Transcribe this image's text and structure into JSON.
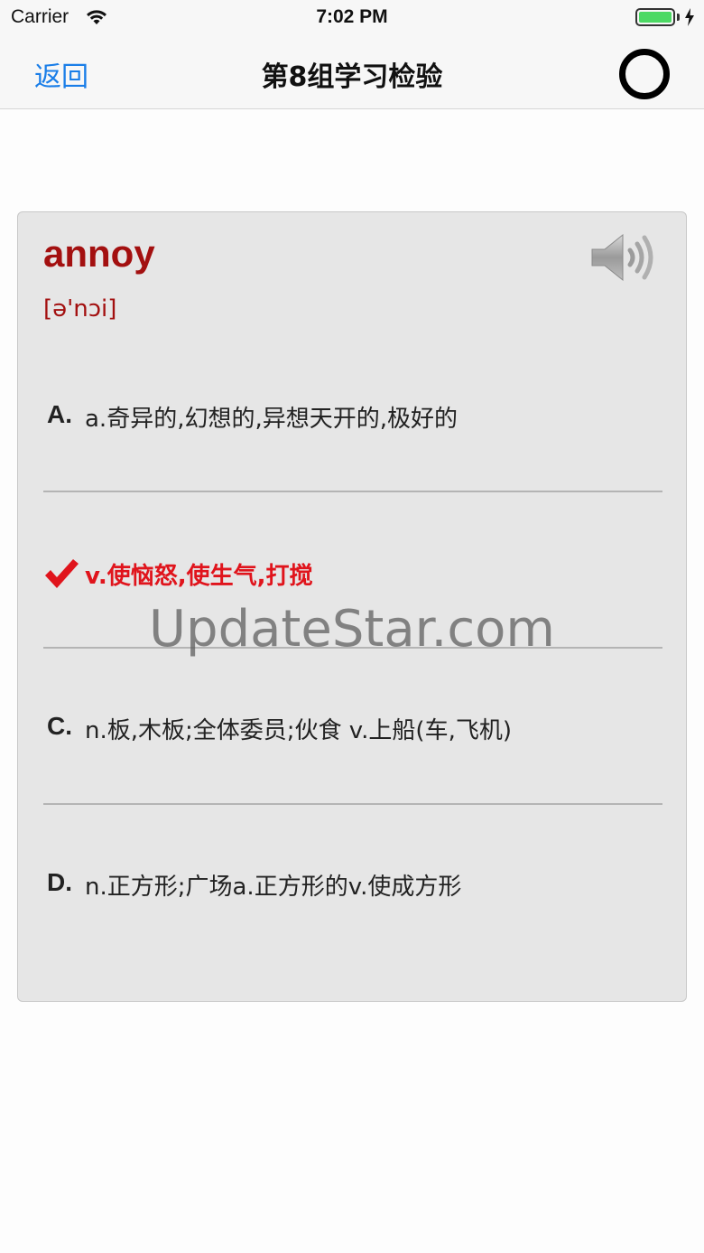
{
  "status_bar": {
    "carrier": "Carrier",
    "time": "7:02 PM",
    "battery_color": "#4cd964"
  },
  "nav": {
    "back_label": "返回",
    "title": "第8组学习检验",
    "right_icon": "circle-icon",
    "accent_color": "#1a7ee8"
  },
  "card": {
    "word": "annoy",
    "phonetic": "[ə'nɔi]",
    "word_color": "#a31010",
    "speaker_icon": "speaker-icon",
    "options": [
      {
        "letter": "A.",
        "text": "a.奇异的,幻想的,异想天开的,极好的",
        "state": "normal"
      },
      {
        "letter": "",
        "text": "v.使恼怒,使生气,打搅",
        "state": "correct"
      },
      {
        "letter": "C.",
        "text": "n.板,木板;全体委员;伙食 v.上船(车,飞机)",
        "state": "normal"
      },
      {
        "letter": "D.",
        "text": "n.正方形;广场a.正方形的v.使成方形",
        "state": "normal"
      }
    ],
    "correct_color": "#e0141c"
  },
  "watermark": "UpdateStar.com"
}
